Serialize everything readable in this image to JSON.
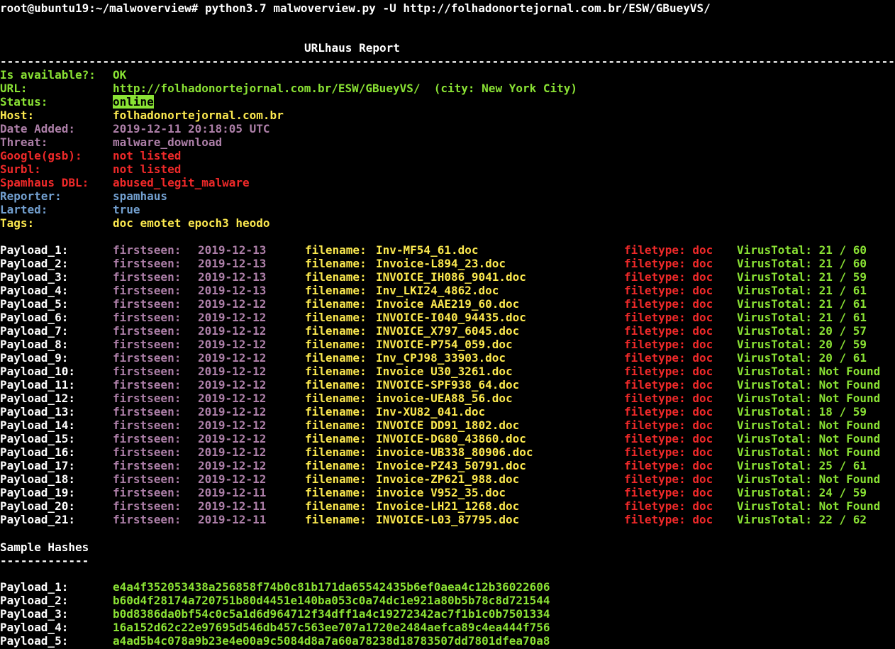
{
  "prompt": "root@ubuntu19:~/malwoverview# python3.7 malwoverview.py -U http://folhadonortejornal.com.br/ESW/GBueyVS/",
  "report_title": "URLhaus Report",
  "separator": "-----------------------------------------------------------------------------------------------------------------------------------------------------------------------",
  "fields": [
    {
      "label": "Is available?:",
      "value": "OK",
      "color": "#8ae234"
    },
    {
      "label": "URL:",
      "value": "http://folhadonortejornal.com.br/ESW/GBueyVS/  (city: New York City)",
      "color": "#8ae234"
    },
    {
      "label": "Status:",
      "value": "online",
      "color": "#8ae234",
      "highlight": true
    },
    {
      "label": "Host:",
      "value": "folhadonortejornal.com.br",
      "color": "#fce94f"
    },
    {
      "label": "Date Added:",
      "value": "2019-12-11 20:18:05 UTC",
      "color": "#ad7fa8"
    },
    {
      "label": "Threat:",
      "value": "malware_download",
      "color": "#ad7fa8"
    },
    {
      "label": "Google(gsb):",
      "value": "not listed",
      "color": "#ef2929"
    },
    {
      "label": "Surbl:",
      "value": "not listed",
      "color": "#ef2929"
    },
    {
      "label": "Spamhaus DBL:",
      "value": "abused_legit_malware",
      "color": "#ef2929"
    },
    {
      "label": "Reporter:",
      "value": "spamhaus",
      "color": "#729fcf"
    },
    {
      "label": "Larted:",
      "value": "true",
      "color": "#729fcf"
    },
    {
      "label": "Tags:",
      "value": "doc emotet epoch3 heodo",
      "color": "#fce94f"
    }
  ],
  "payload_labels": {
    "firstseen": "firstseen:",
    "filename": "filename:",
    "filetype": "filetype:",
    "virustotal": "VirusTotal:"
  },
  "payloads": [
    {
      "name": "Payload_1:",
      "firstseen": "2019-12-13",
      "filename": "Inv-MF54_61.doc",
      "filetype": "doc",
      "vt": "21 / 60"
    },
    {
      "name": "Payload_2:",
      "firstseen": "2019-12-13",
      "filename": "Invoice-L894_23.doc",
      "filetype": "doc",
      "vt": "21 / 60"
    },
    {
      "name": "Payload_3:",
      "firstseen": "2019-12-13",
      "filename": "INVOICE_IH086_9041.doc",
      "filetype": "doc",
      "vt": "21 / 59"
    },
    {
      "name": "Payload_4:",
      "firstseen": "2019-12-13",
      "filename": "Inv_LKI24_4862.doc",
      "filetype": "doc",
      "vt": "21 / 61"
    },
    {
      "name": "Payload_5:",
      "firstseen": "2019-12-12",
      "filename": "Invoice AAE219_60.doc",
      "filetype": "doc",
      "vt": "21 / 61"
    },
    {
      "name": "Payload_6:",
      "firstseen": "2019-12-12",
      "filename": "INVOICE-I040_94435.doc",
      "filetype": "doc",
      "vt": "21 / 61"
    },
    {
      "name": "Payload_7:",
      "firstseen": "2019-12-12",
      "filename": "INVOICE_X797_6045.doc",
      "filetype": "doc",
      "vt": "20 / 57"
    },
    {
      "name": "Payload_8:",
      "firstseen": "2019-12-12",
      "filename": "INVOICE-P754_059.doc",
      "filetype": "doc",
      "vt": "20 / 59"
    },
    {
      "name": "Payload_9:",
      "firstseen": "2019-12-12",
      "filename": "Inv_CPJ98_33903.doc",
      "filetype": "doc",
      "vt": "20 / 61"
    },
    {
      "name": "Payload_10:",
      "firstseen": "2019-12-12",
      "filename": "Invoice U30_3261.doc",
      "filetype": "doc",
      "vt": "Not Found"
    },
    {
      "name": "Payload_11:",
      "firstseen": "2019-12-12",
      "filename": "INVOICE-SPF938_64.doc",
      "filetype": "doc",
      "vt": "Not Found"
    },
    {
      "name": "Payload_12:",
      "firstseen": "2019-12-12",
      "filename": "invoice-UEA88_56.doc",
      "filetype": "doc",
      "vt": "Not Found"
    },
    {
      "name": "Payload_13:",
      "firstseen": "2019-12-12",
      "filename": "Inv-XU82_041.doc",
      "filetype": "doc",
      "vt": "18 / 59"
    },
    {
      "name": "Payload_14:",
      "firstseen": "2019-12-12",
      "filename": "INVOICE DD91_1802.doc",
      "filetype": "doc",
      "vt": "Not Found"
    },
    {
      "name": "Payload_15:",
      "firstseen": "2019-12-12",
      "filename": "INVOICE-DG80_43860.doc",
      "filetype": "doc",
      "vt": "Not Found"
    },
    {
      "name": "Payload_16:",
      "firstseen": "2019-12-12",
      "filename": "invoice-UB338_80906.doc",
      "filetype": "doc",
      "vt": "Not Found"
    },
    {
      "name": "Payload_17:",
      "firstseen": "2019-12-12",
      "filename": "Invoice-PZ43_50791.doc",
      "filetype": "doc",
      "vt": "25 / 61"
    },
    {
      "name": "Payload_18:",
      "firstseen": "2019-12-12",
      "filename": "Invoice-ZP621_988.doc",
      "filetype": "doc",
      "vt": "Not Found"
    },
    {
      "name": "Payload_19:",
      "firstseen": "2019-12-11",
      "filename": "invoice V952_35.doc",
      "filetype": "doc",
      "vt": "24 / 59"
    },
    {
      "name": "Payload_20:",
      "firstseen": "2019-12-11",
      "filename": "Invoice-LH21_1268.doc",
      "filetype": "doc",
      "vt": "Not Found"
    },
    {
      "name": "Payload_21:",
      "firstseen": "2019-12-11",
      "filename": "INVOICE-L03_87795.doc",
      "filetype": "doc",
      "vt": "22 / 62"
    }
  ],
  "hashes_title": "Sample Hashes",
  "hashes_underline": "-------------",
  "hashes": [
    {
      "name": "Payload_1:",
      "hash": "e4a4f352053438a256858f74b0c81b171da65542435b6ef0aea4c12b36022606"
    },
    {
      "name": "Payload_2:",
      "hash": "b60d4f28174a720751b80d4451e140ba053c0a74dc1e921a80b5b78c8d721544"
    },
    {
      "name": "Payload_3:",
      "hash": "b0d8386da0bf54c0c5a1d6d964712f34dff1a4c19272342ac7f1b1c0b7501334"
    },
    {
      "name": "Payload_4:",
      "hash": "16a152d62c22e97695d546db457c563ee707a1720e2484aefca89c4ea444f756"
    },
    {
      "name": "Payload_5:",
      "hash": "a4ad5b4c078a9b23e4e00a9c5084d8a7a60a78238d18783507dd7801dfea70a8"
    }
  ],
  "colors": {
    "background": "#000000",
    "text": "#ffffff",
    "green": "#8ae234",
    "yellow": "#fce94f",
    "purple": "#ad7fa8",
    "red": "#ef2929",
    "blue": "#729fcf"
  }
}
